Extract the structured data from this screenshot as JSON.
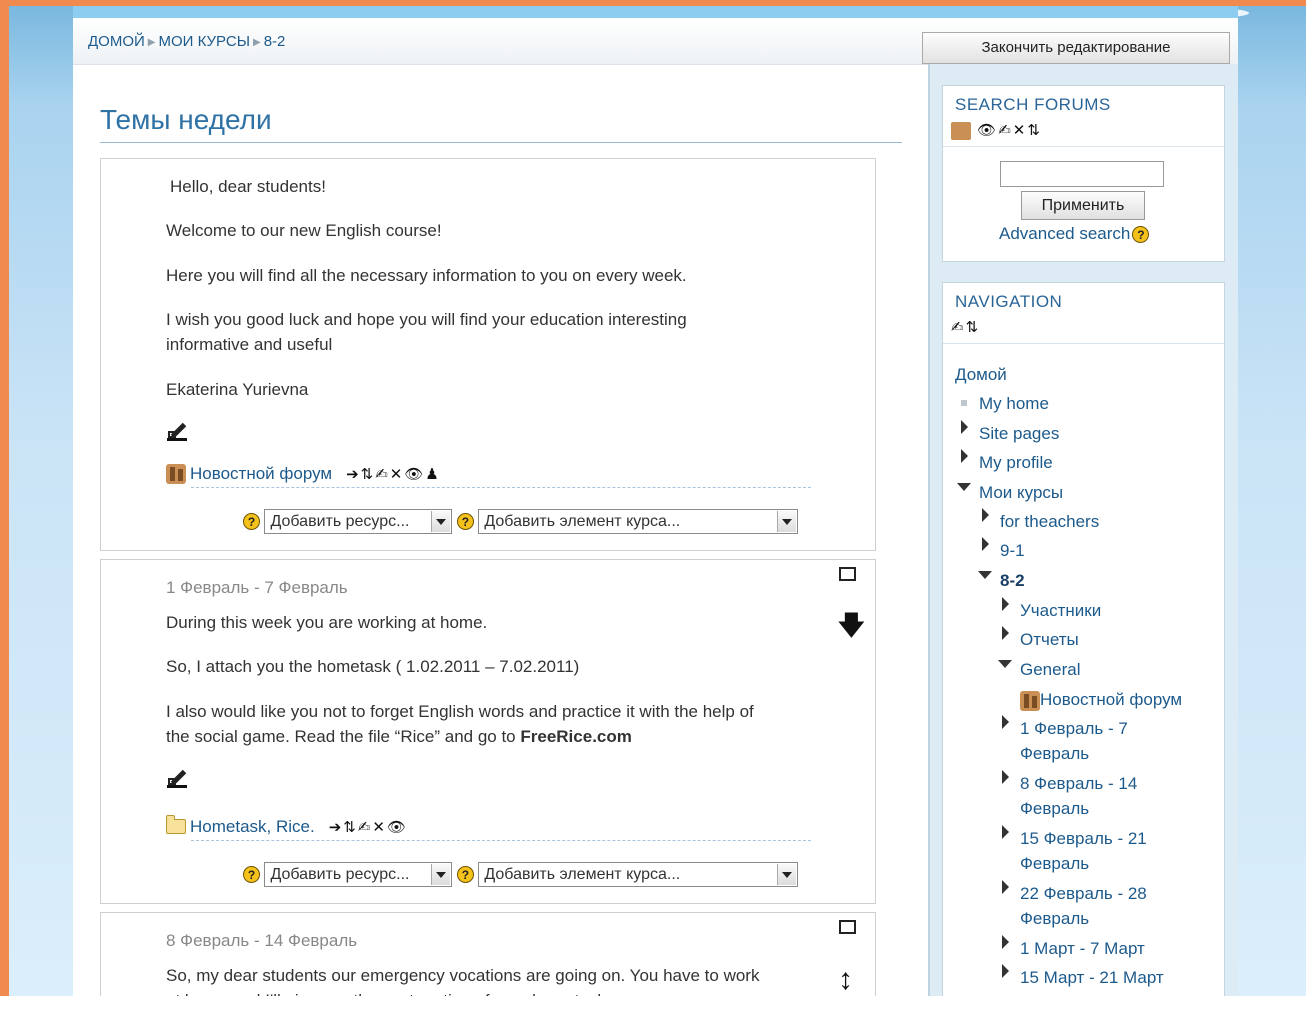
{
  "breadcrumb": {
    "home": "ДОМОЙ",
    "courses": "МОИ КУРСЫ",
    "course": "8-2"
  },
  "edit_button": "Закончить редактирование",
  "page_title": "Темы недели",
  "sections": {
    "general": {
      "lines": [
        "Hello, dear students!",
        "Welcome to our new English course!",
        "Here you will find all the necessary information to you on every week.",
        "I wish you good luck and hope you will find your education interesting",
        "informative and useful",
        "Ekaterina Yurievna"
      ],
      "activity": "Новостной форум",
      "activity_icons": "➔⇅✍✕👁♟"
    },
    "week1": {
      "date": "1 Февраль - 7 Февраль",
      "lines": [
        "During this week you are working at home.",
        "So, I attach you the hometask ( 1.02.2011 – 7.02.2011)",
        "I also would like you not to forget English words and practice it with the help of",
        "the social game. Read the file “Rice” and go to "
      ],
      "link_bold": "FreeRice.com",
      "activity": "Hometask, Rice.",
      "activity_icons": "➔⇅✍✕👁"
    },
    "week2": {
      "date": "8 Февраль - 14 Февраль",
      "lines": [
        "So, my dear students our emergency vocations are going on. You have to work",
        "at home and I'll give you the next portion of your hometask"
      ]
    }
  },
  "add_resource": "Добавить ресурс...",
  "add_activity": "Добавить элемент курса...",
  "help_glyph": "?",
  "move_down_glyph": "🡇",
  "move_updown_glyph": "↕",
  "search_block": {
    "title": "SEARCH FORUMS",
    "icons": "👁✍✕⇅",
    "apply": "Применить",
    "advanced": "Advanced search"
  },
  "nav_block": {
    "title": "NAVIGATION",
    "icons": "✍⇅",
    "items": [
      "Домой",
      "My home",
      "Site pages",
      "My profile",
      "Мои курсы",
      "for theachers",
      "9-1",
      "8-2",
      "Участники",
      "Отчеты",
      "General",
      "Новостной форум",
      "1 Февраль - 7",
      "Февраль",
      "8 Февраль - 14",
      "Февраль",
      "15 Февраль - 21",
      "Февраль",
      "22 Февраль - 28",
      "Февраль",
      "1 Март - 7 Март",
      "15 Март - 21 Март"
    ]
  },
  "colors": {
    "accent": "#1d5a8c",
    "title": "#2f72a6",
    "frame": "#f08a4e"
  }
}
